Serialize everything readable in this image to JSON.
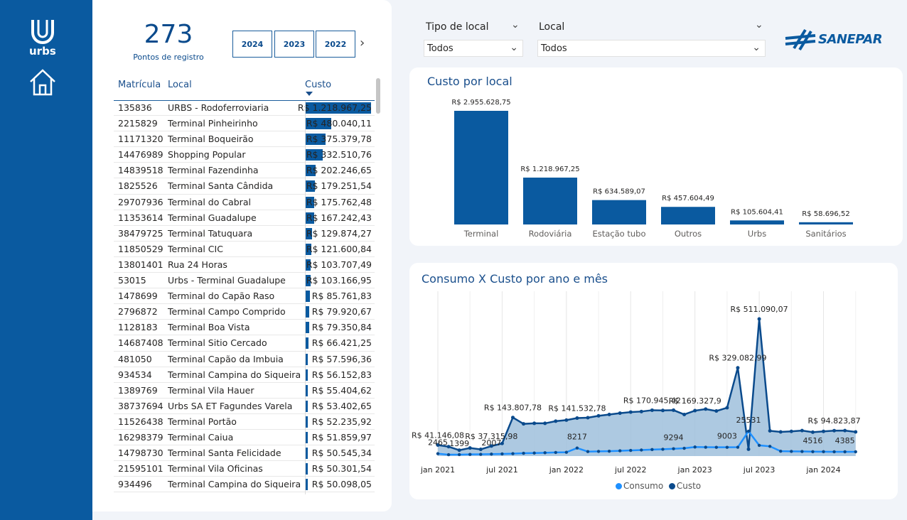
{
  "brand": {
    "logo_text": "urbs",
    "partner_logo": "SANEPAR"
  },
  "kpi": {
    "value": "273",
    "label": "Pontos de registro"
  },
  "years": [
    "2024",
    "2023",
    "2022"
  ],
  "table": {
    "headers": [
      "Matrícula",
      "Local",
      "Custo"
    ],
    "max": 1218967.25,
    "rows": [
      {
        "mat": "135836",
        "local": "URBS - Rodoferroviaria",
        "custo": "R$ 1.218.967,25",
        "v": 1218967.25
      },
      {
        "mat": "2215829",
        "local": "Terminal Pinheirinho",
        "custo": "R$ 480.040,11",
        "v": 480040.11
      },
      {
        "mat": "11171320",
        "local": "Terminal Boqueirão",
        "custo": "R$ 375.379,78",
        "v": 375379.78
      },
      {
        "mat": "14476989",
        "local": "Shopping Popular",
        "custo": "R$ 332.510,76",
        "v": 332510.76
      },
      {
        "mat": "14839518",
        "local": "Terminal Fazendinha",
        "custo": "R$ 202.246,65",
        "v": 202246.65
      },
      {
        "mat": "1825526",
        "local": "Terminal Santa Cândida",
        "custo": "R$ 179.251,54",
        "v": 179251.54
      },
      {
        "mat": "29707936",
        "local": "Terminal do Cabral",
        "custo": "R$ 175.762,48",
        "v": 175762.48
      },
      {
        "mat": "11353614",
        "local": "Terminal Guadalupe",
        "custo": "R$ 167.242,43",
        "v": 167242.43
      },
      {
        "mat": "38479725",
        "local": "Terminal Tatuquara",
        "custo": "R$ 129.874,27",
        "v": 129874.27
      },
      {
        "mat": "11850529",
        "local": "Terminal CIC",
        "custo": "R$ 121.600,84",
        "v": 121600.84
      },
      {
        "mat": "13801401",
        "local": "Rua 24 Horas",
        "custo": "R$ 103.707,49",
        "v": 103707.49
      },
      {
        "mat": "53015",
        "local": "Urbs - Terminal Guadalupe",
        "custo": "R$ 103.166,95",
        "v": 103166.95
      },
      {
        "mat": "1478699",
        "local": "Terminal do Capão Raso",
        "custo": "R$ 85.761,83",
        "v": 85761.83
      },
      {
        "mat": "2796872",
        "local": "Terminal Campo Comprido",
        "custo": "R$ 79.920,67",
        "v": 79920.67
      },
      {
        "mat": "1128183",
        "local": "Terminal Boa Vista",
        "custo": "R$ 79.350,84",
        "v": 79350.84
      },
      {
        "mat": "14687408",
        "local": "Terminal Sitio Cercado",
        "custo": "R$ 66.421,25",
        "v": 66421.25
      },
      {
        "mat": "481050",
        "local": "Terminal Capão da Imbuia",
        "custo": "R$ 57.596,36",
        "v": 57596.36
      },
      {
        "mat": "934534",
        "local": "Terminal Campina do Siqueira",
        "custo": "R$ 56.152,83",
        "v": 56152.83
      },
      {
        "mat": "1389769",
        "local": "Terminal Vila Hauer",
        "custo": "R$ 55.404,62",
        "v": 55404.62
      },
      {
        "mat": "38737694",
        "local": "Urbs SA ET Fagundes Varela",
        "custo": "R$ 53.402,65",
        "v": 53402.65
      },
      {
        "mat": "11526438",
        "local": "Terminal Portão",
        "custo": "R$ 52.235,92",
        "v": 52235.92
      },
      {
        "mat": "16298379",
        "local": "Terminal Caiua",
        "custo": "R$ 51.859,97",
        "v": 51859.97
      },
      {
        "mat": "14798730",
        "local": "Terminal Santa Felicidade",
        "custo": "R$ 50.545,34",
        "v": 50545.34
      },
      {
        "mat": "21595101",
        "local": "Terminal Vila Oficinas",
        "custo": "R$ 50.301,54",
        "v": 50301.54
      },
      {
        "mat": "934496",
        "local": "Terminal Campina do Siqueira",
        "custo": "R$ 50.098,05",
        "v": 50098.05
      }
    ]
  },
  "filters": {
    "tipo": {
      "label": "Tipo de local",
      "value": "Todos"
    },
    "local": {
      "label": "Local",
      "value": "Todos"
    }
  },
  "colors": {
    "primary": "#0a5aa0",
    "consumo": "#1e90ff",
    "area": "#9fbfdc"
  },
  "chart_data": [
    {
      "type": "bar",
      "title": "Custo por local",
      "categories": [
        "Terminal",
        "Rodoviária",
        "Estação tubo",
        "Outros",
        "Urbs",
        "Sanitários"
      ],
      "values": [
        2955628.75,
        1218967.25,
        634589.07,
        457604.49,
        105604.41,
        58696.52
      ],
      "labels": [
        "R$ 2.955.628,75",
        "R$ 1.218.967,25",
        "R$ 634.589,07",
        "R$ 457.604,49",
        "R$ 105.604,41",
        "R$ 58.696,52"
      ]
    },
    {
      "type": "line",
      "title": "Consumo X Custo por ano e mês",
      "x_ticks": [
        "jan 2021",
        "jul 2021",
        "jan 2022",
        "jul 2022",
        "jan 2023",
        "jul 2023",
        "jan 2024"
      ],
      "legend": [
        "Consumo",
        "Custo"
      ],
      "series": [
        {
          "name": "Custo",
          "values": [
            41146.08,
            35000,
            22000,
            30000,
            25000,
            37315.98,
            47000,
            143807.78,
            120000,
            122000,
            122000,
            130000,
            134000,
            141532.78,
            143000,
            150000,
            155000,
            160000,
            164000,
            166000,
            170945.42,
            170000,
            171000,
            155000,
            169327.9,
            175000,
            168000,
            180000,
            329082.99,
            25531,
            511090.07,
            94000,
            90000,
            92000,
            95000,
            89000,
            92000,
            94823.87,
            95000,
            90000
          ]
        },
        {
          "name": "Consumo",
          "values": [
            2465,
            1399,
            1500,
            1700,
            1800,
            2007,
            2200,
            2500,
            2900,
            3100,
            3400,
            3700,
            3900,
            8217,
            4600,
            4800,
            5000,
            5400,
            5800,
            6200,
            6700,
            7000,
            7500,
            8000,
            9294,
            9100,
            9000,
            9003,
            9100,
            25531,
            11000,
            10000,
            5000,
            4800,
            4700,
            4516,
            4500,
            4400,
            4385,
            4385
          ]
        }
      ],
      "labels": [
        {
          "i": 0,
          "s": "Custo",
          "text": "R$ 41.146,08"
        },
        {
          "i": 5,
          "s": "Custo",
          "text": "R$ 37.315,98"
        },
        {
          "i": 7,
          "s": "Custo",
          "text": "R$ 143.807,78"
        },
        {
          "i": 13,
          "s": "Custo",
          "text": "R$ 141.532,78"
        },
        {
          "i": 20,
          "s": "Custo",
          "text": "R$ 170.945,42"
        },
        {
          "i": 24,
          "s": "Custo",
          "text": "R$ 169.327,9"
        },
        {
          "i": 28,
          "s": "Custo",
          "text": "R$ 329.082,99"
        },
        {
          "i": 30,
          "s": "Custo",
          "text": "R$ 511.090,07"
        },
        {
          "i": 37,
          "s": "Custo",
          "text": "R$ 94.823,87"
        },
        {
          "i": 0,
          "s": "Consumo",
          "text": "2465"
        },
        {
          "i": 2,
          "s": "Consumo",
          "text": "1399"
        },
        {
          "i": 5,
          "s": "Consumo",
          "text": "2007"
        },
        {
          "i": 13,
          "s": "Consumo",
          "text": "8217"
        },
        {
          "i": 22,
          "s": "Consumo",
          "text": "9294"
        },
        {
          "i": 27,
          "s": "Consumo",
          "text": "9003"
        },
        {
          "i": 29,
          "s": "Consumo",
          "text": "25531"
        },
        {
          "i": 35,
          "s": "Consumo",
          "text": "4516"
        },
        {
          "i": 38,
          "s": "Consumo",
          "text": "4385"
        }
      ]
    }
  ]
}
